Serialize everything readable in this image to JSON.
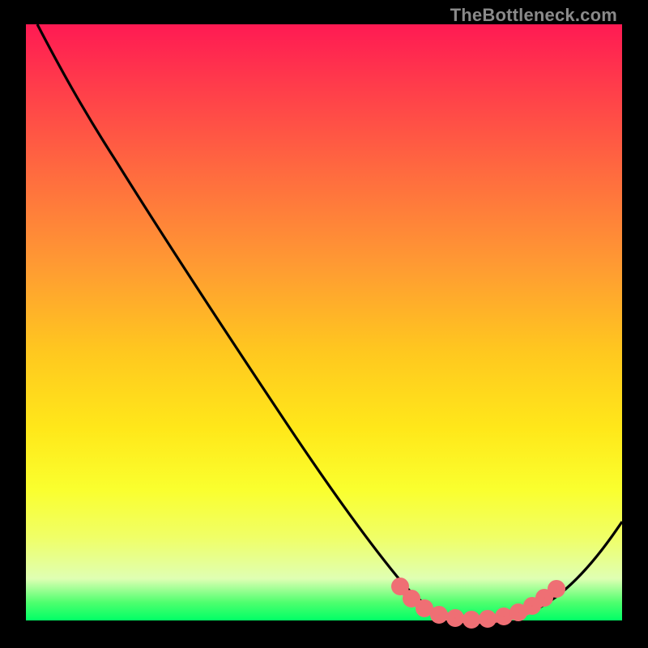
{
  "watermark": "TheBottleneck.com",
  "chart_data": {
    "type": "line",
    "title": "",
    "xlabel": "",
    "ylabel": "",
    "xlim": [
      0,
      100
    ],
    "ylim": [
      0,
      100
    ],
    "series": [
      {
        "name": "curve",
        "color": "#000000",
        "points": [
          {
            "x": 2,
            "y": 100
          },
          {
            "x": 10,
            "y": 89
          },
          {
            "x": 18,
            "y": 76
          },
          {
            "x": 26,
            "y": 63
          },
          {
            "x": 34,
            "y": 50
          },
          {
            "x": 42,
            "y": 37
          },
          {
            "x": 50,
            "y": 24
          },
          {
            "x": 57,
            "y": 13
          },
          {
            "x": 63,
            "y": 5
          },
          {
            "x": 68,
            "y": 1
          },
          {
            "x": 74,
            "y": 0
          },
          {
            "x": 80,
            "y": 0
          },
          {
            "x": 85,
            "y": 2
          },
          {
            "x": 90,
            "y": 6
          },
          {
            "x": 95,
            "y": 12
          },
          {
            "x": 100,
            "y": 20
          }
        ]
      }
    ],
    "highlight": {
      "name": "optimal-range",
      "color": "#ef6f74",
      "dots": [
        {
          "x": 63,
          "y": 5.5
        },
        {
          "x": 65,
          "y": 3.2
        },
        {
          "x": 67,
          "y": 1.7
        },
        {
          "x": 69,
          "y": 0.8
        },
        {
          "x": 71,
          "y": 0.3
        },
        {
          "x": 73,
          "y": 0.1
        },
        {
          "x": 75,
          "y": 0.0
        },
        {
          "x": 77,
          "y": 0.1
        },
        {
          "x": 79,
          "y": 0.3
        },
        {
          "x": 81,
          "y": 0.8
        },
        {
          "x": 83,
          "y": 1.7
        },
        {
          "x": 85,
          "y": 3.0
        },
        {
          "x": 87,
          "y": 5.0
        }
      ]
    }
  }
}
